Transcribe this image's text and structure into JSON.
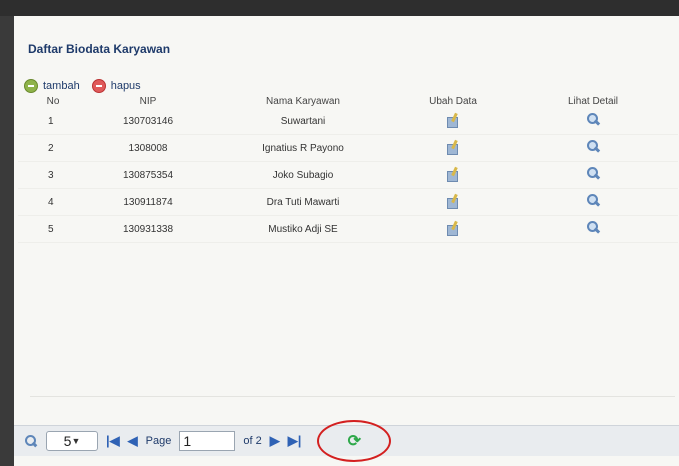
{
  "title": "Daftar Biodata Karyawan",
  "toolbar": {
    "add_label": "tambah",
    "delete_label": "hapus"
  },
  "columns": {
    "no": "No",
    "nip": "NIP",
    "nama": "Nama Karyawan",
    "ubah": "Ubah Data",
    "lihat": "Lihat Detail"
  },
  "rows": [
    {
      "no": "1",
      "nip": "130703146",
      "nama": "Suwartani"
    },
    {
      "no": "2",
      "nip": "1308008",
      "nama": "Ignatius R Payono"
    },
    {
      "no": "3",
      "nip": "130875354",
      "nama": "Joko Subagio"
    },
    {
      "no": "4",
      "nip": "130911874",
      "nama": "Dra Tuti Mawarti"
    },
    {
      "no": "5",
      "nip": "130931338",
      "nama": "Mustiko Adji SE"
    }
  ],
  "pager": {
    "page_size": "5",
    "page_label": "Page",
    "page_value": "1",
    "of_label": "of 2"
  },
  "icons": {
    "add": "add-circle-icon",
    "delete": "delete-circle-icon",
    "edit": "edit-icon",
    "view": "magnifier-icon",
    "refresh": "refresh-icon"
  },
  "colors": {
    "title": "#1e3a6a",
    "accent_blue": "#2f62b5",
    "refresh_green": "#2ea84a",
    "highlight_red": "#d32020"
  }
}
